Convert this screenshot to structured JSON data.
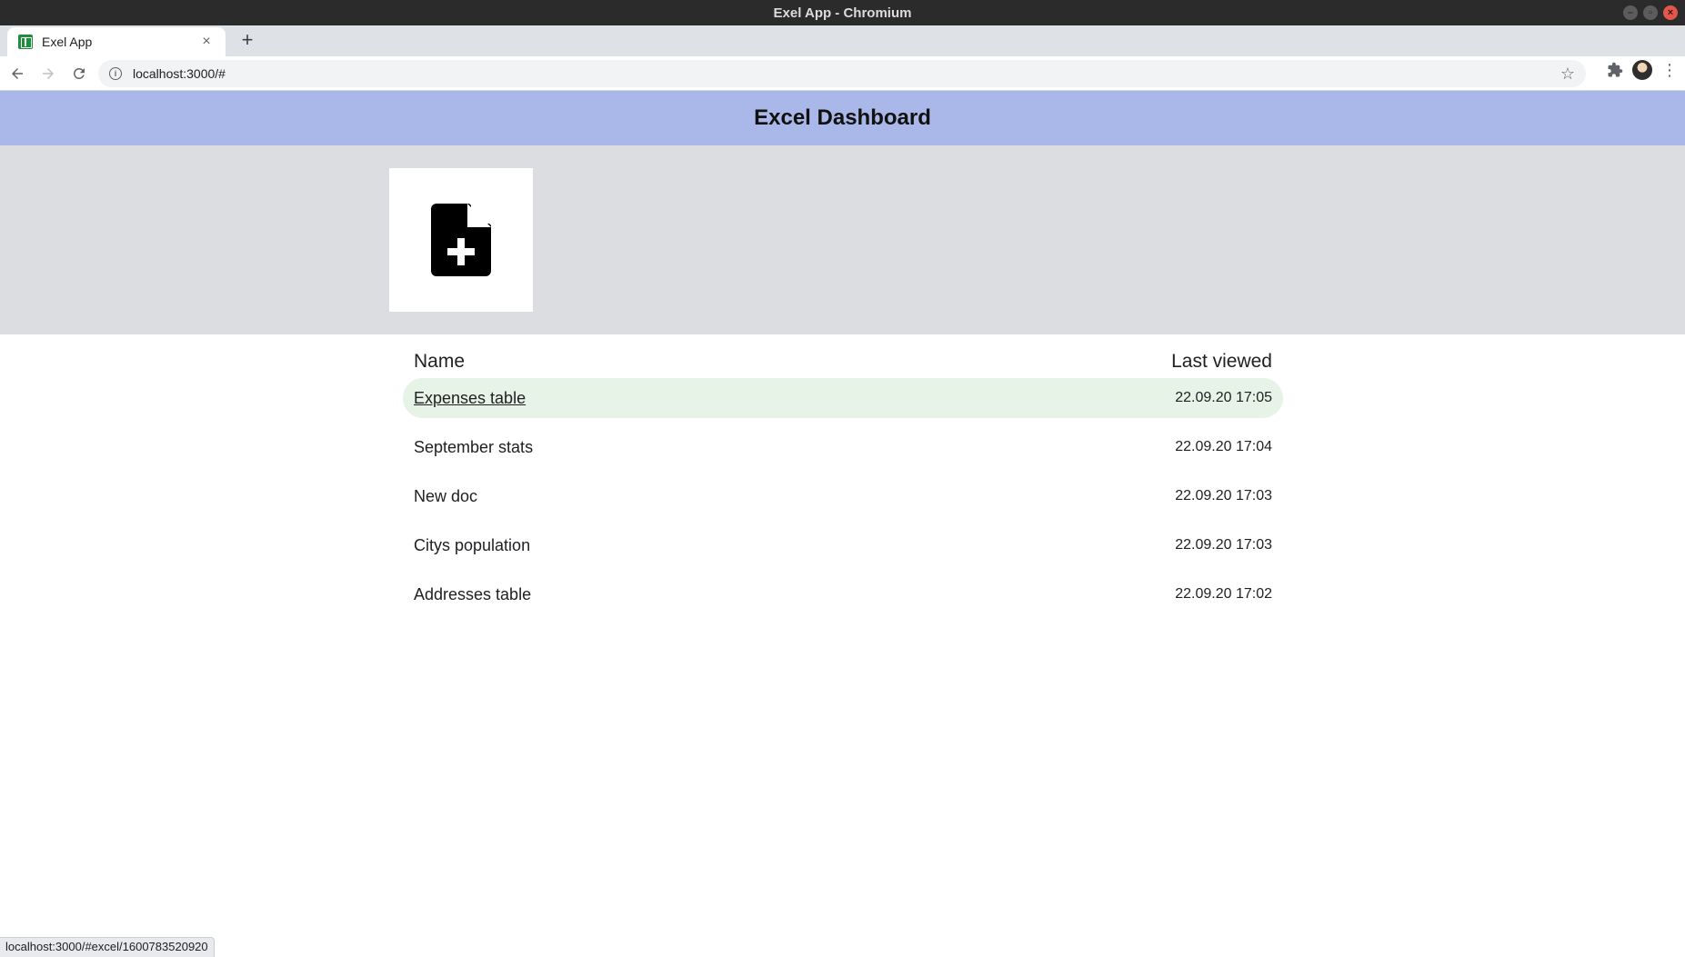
{
  "os": {
    "window_title": "Exel App - Chromium"
  },
  "browser": {
    "tab_title": "Exel App",
    "url": "localhost:3000/#",
    "status_url": "localhost:3000/#excel/1600783520920"
  },
  "app": {
    "title": "Excel Dashboard",
    "list": {
      "col_name": "Name",
      "col_date": "Last viewed",
      "rows": [
        {
          "name": "Expenses table",
          "date": "22.09.20 17:05"
        },
        {
          "name": "September stats",
          "date": "22.09.20 17:04"
        },
        {
          "name": "New doc",
          "date": "22.09.20 17:03"
        },
        {
          "name": "Citys population",
          "date": "22.09.20 17:03"
        },
        {
          "name": "Addresses table",
          "date": "22.09.20 17:02"
        }
      ]
    }
  },
  "icons": {
    "create": "file-plus-icon",
    "favicon": "sheets-favicon-icon"
  },
  "colors": {
    "header_bg": "#a9b8e8",
    "create_bg": "#dcdde1",
    "row_hover_bg": "#e6f3e6"
  }
}
